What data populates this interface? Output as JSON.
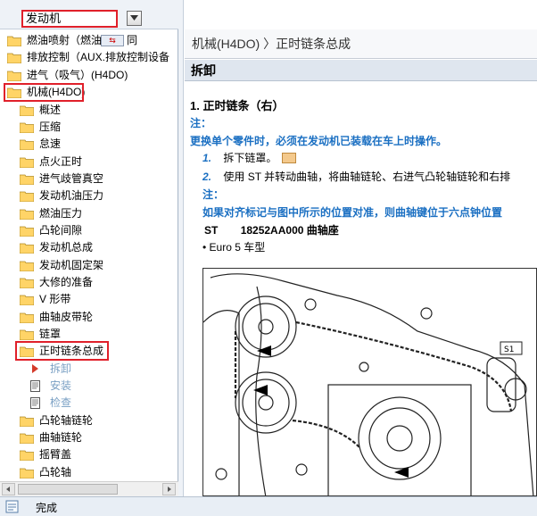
{
  "combo": {
    "value": "发动机"
  },
  "tree": {
    "items": [
      {
        "label": "燃油喷射（燃油",
        "level": 0
      },
      {
        "label": "排放控制（AUX.排放控制设备",
        "level": 0
      },
      {
        "label": "进气（吸气）(H4DO)",
        "level": 0
      },
      {
        "label": "机械(H4DO)",
        "level": 0
      },
      {
        "label": "概述",
        "level": 1
      },
      {
        "label": "压缩",
        "level": 1
      },
      {
        "label": "怠速",
        "level": 1
      },
      {
        "label": "点火正时",
        "level": 1
      },
      {
        "label": "进气歧管真空",
        "level": 1
      },
      {
        "label": "发动机油压力",
        "level": 1
      },
      {
        "label": "燃油压力",
        "level": 1
      },
      {
        "label": "凸轮间隙",
        "level": 1
      },
      {
        "label": "发动机总成",
        "level": 1
      },
      {
        "label": "发动机固定架",
        "level": 1
      },
      {
        "label": "大修的准备",
        "level": 1
      },
      {
        "label": "V 形带",
        "level": 1
      },
      {
        "label": "曲轴皮带轮",
        "level": 1
      },
      {
        "label": "链罩",
        "level": 1
      },
      {
        "label": "正时链条总成",
        "level": 1
      },
      {
        "label": "拆卸",
        "level": 2
      },
      {
        "label": "安装",
        "level": 2
      },
      {
        "label": "检查",
        "level": 2
      },
      {
        "label": "凸轮轴链轮",
        "level": 1
      },
      {
        "label": "曲轴链轮",
        "level": 1
      },
      {
        "label": "摇臂盖",
        "level": 1
      },
      {
        "label": "凸轮轴",
        "level": 1
      }
    ],
    "overlay_icon_text": "同"
  },
  "content": {
    "breadcrumb": "机械(H4DO) 〉正时链条总成",
    "section_title": "拆卸",
    "heading": "1.  正时链条（右）",
    "note1_label": "注：",
    "note1_text": "更换单个零件时，必须在发动机已装载在车上时操作。",
    "step1_num": "1.",
    "step1_text": "拆下链罩。",
    "step2_num": "2.",
    "step2_text": "使用 ST 并转动曲轴，将曲轴链轮、右进气凸轮轴链轮和右排",
    "note2_label": "注：",
    "note2_text": "如果对齐标记与图中所示的位置对准，则曲轴键位于六点钟位置",
    "st_label": "ST",
    "st_text": "18252AA000 曲轴座",
    "bullet_text": "• Euro 5 车型",
    "figure_label": "S1"
  },
  "status": {
    "text": "完成"
  },
  "colors": {
    "highlight": "#e0202a",
    "note_blue": "#1a6fc2",
    "folder": "#ffd467"
  }
}
